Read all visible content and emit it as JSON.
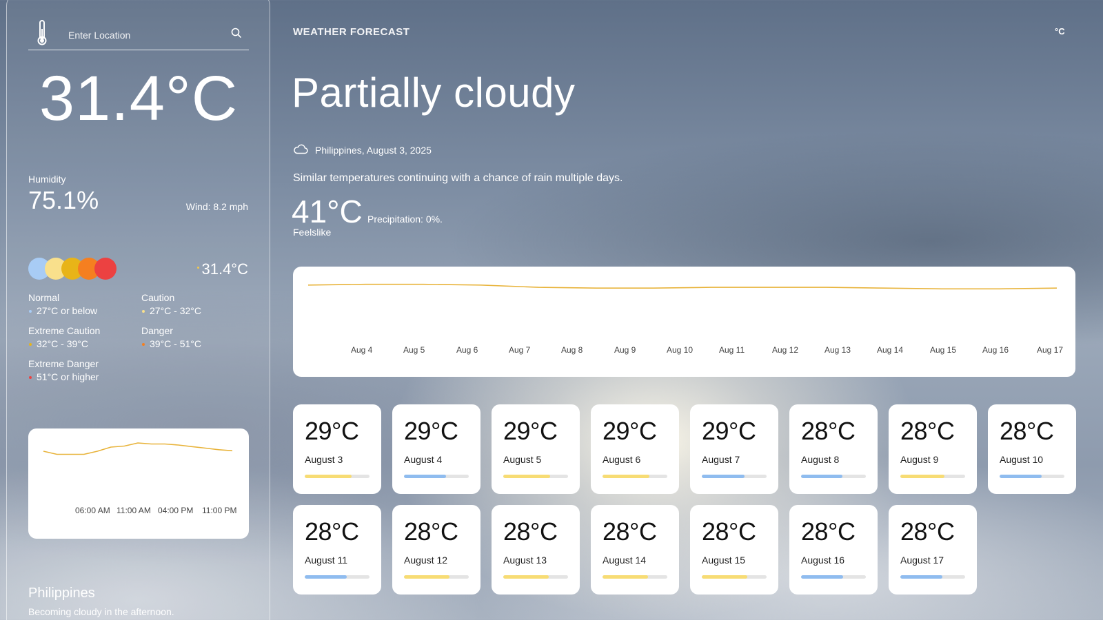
{
  "sidebar": {
    "search": {
      "placeholder": "Enter Location",
      "icon": "search-icon"
    },
    "thermo_icon": "thermometer-icon",
    "temperature": "31.4°C",
    "humidity_label": "Humidity",
    "humidity_value": "75.1%",
    "wind": "Wind: 8.2 mph",
    "heat_index": "31.4°C",
    "heat_circles": [
      "#a8ccf5",
      "#f9e08c",
      "#e8b418",
      "#f57f20",
      "#ec4141"
    ],
    "legend": [
      {
        "title": "Normal",
        "range": "27°C or below",
        "color": "#a8ccf5"
      },
      {
        "title": "Caution",
        "range": "27°C - 32°C",
        "color": "#f9e08c"
      },
      {
        "title": "Extreme Caution",
        "range": "32°C - 39°C",
        "color": "#e8b418"
      },
      {
        "title": "Danger",
        "range": "39°C - 51°C",
        "color": "#f57f20"
      },
      {
        "title": "Extreme Danger",
        "range": "51°C or higher",
        "color": "#ec4141"
      }
    ],
    "hourly_chart": {
      "type": "line",
      "x_ticks": [
        "06:00 AM",
        "11:00 AM",
        "04:00 PM",
        "11:00 PM"
      ],
      "series": [
        {
          "values": [
            29.6,
            29.0,
            29.0,
            29.0,
            29.6,
            30.4,
            30.6,
            31.2,
            31.0,
            31.0,
            30.8,
            30.5,
            30.2,
            29.9,
            29.7
          ]
        }
      ],
      "color": "#e8b33a"
    },
    "location_name": "Philippines",
    "location_desc": "Becoming cloudy in the afternoon."
  },
  "header": {
    "title": "WEATHER FORECAST",
    "unit": "°C"
  },
  "current": {
    "condition": "Partially cloudy",
    "condition_icon": "cloud-icon",
    "location_date": "Philippines, August 3, 2025",
    "summary": "Similar temperatures continuing with a chance of rain multiple days.",
    "feelslike_value": "41°C",
    "feelslike_label": "Feelslike",
    "precipitation": "Precipitation: 0%."
  },
  "chart_data": {
    "type": "line",
    "categories": [
      "Aug 4",
      "Aug 5",
      "Aug 6",
      "Aug 7",
      "Aug 8",
      "Aug 9",
      "Aug 10",
      "Aug 11",
      "Aug 12",
      "Aug 13",
      "Aug 14",
      "Aug 15",
      "Aug 16",
      "Aug 17"
    ],
    "series": [
      {
        "values": [
          29.2,
          29.3,
          29.3,
          29.2,
          28.9,
          28.8,
          28.8,
          28.9,
          28.9,
          28.9,
          28.8,
          28.7,
          28.7,
          28.8
        ]
      }
    ],
    "color": "#e8b33a",
    "grid": false
  },
  "daily": [
    {
      "temp": "29°C",
      "date": "August 3",
      "fill": 0.72,
      "color": "#f7dc74"
    },
    {
      "temp": "29°C",
      "date": "August 4",
      "fill": 0.65,
      "color": "#8fbcef"
    },
    {
      "temp": "29°C",
      "date": "August 5",
      "fill": 0.72,
      "color": "#f7dc74"
    },
    {
      "temp": "29°C",
      "date": "August 6",
      "fill": 0.72,
      "color": "#f7dc74"
    },
    {
      "temp": "29°C",
      "date": "August 7",
      "fill": 0.66,
      "color": "#8fbcef"
    },
    {
      "temp": "28°C",
      "date": "August 8",
      "fill": 0.64,
      "color": "#8fbcef"
    },
    {
      "temp": "28°C",
      "date": "August 9",
      "fill": 0.68,
      "color": "#f7dc74"
    },
    {
      "temp": "28°C",
      "date": "August 10",
      "fill": 0.65,
      "color": "#8fbcef"
    },
    {
      "temp": "28°C",
      "date": "August 11",
      "fill": 0.65,
      "color": "#8fbcef"
    },
    {
      "temp": "28°C",
      "date": "August 12",
      "fill": 0.7,
      "color": "#f7dc74"
    },
    {
      "temp": "28°C",
      "date": "August 13",
      "fill": 0.7,
      "color": "#f7dc74"
    },
    {
      "temp": "28°C",
      "date": "August 14",
      "fill": 0.7,
      "color": "#f7dc74"
    },
    {
      "temp": "28°C",
      "date": "August 15",
      "fill": 0.7,
      "color": "#f7dc74"
    },
    {
      "temp": "28°C",
      "date": "August 16",
      "fill": 0.65,
      "color": "#8fbcef"
    },
    {
      "temp": "28°C",
      "date": "August 17",
      "fill": 0.65,
      "color": "#8fbcef"
    }
  ]
}
